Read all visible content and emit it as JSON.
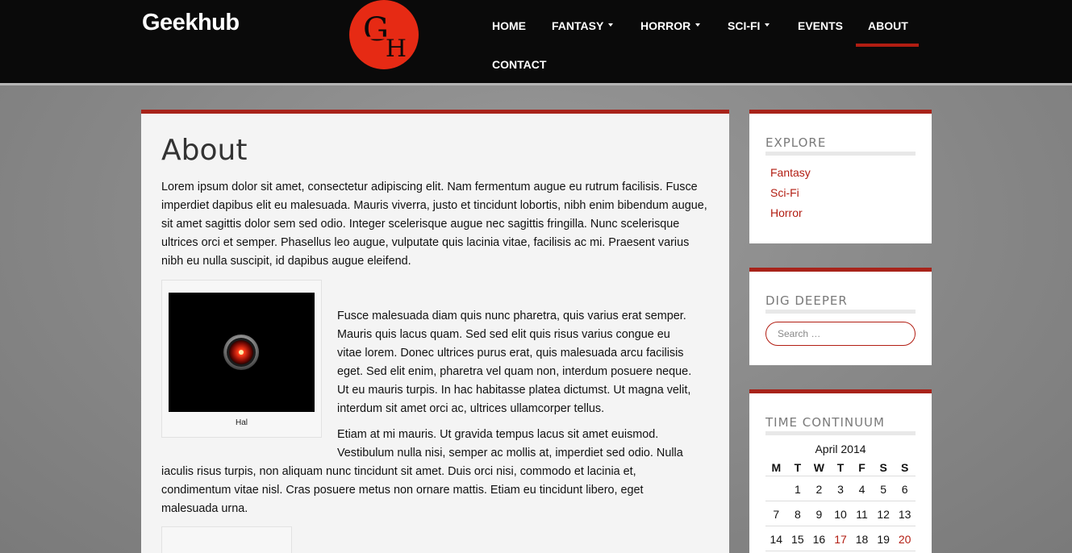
{
  "header": {
    "brand": "Geekhub",
    "logo_text": "GH",
    "nav": [
      {
        "label": "HOME",
        "dropdown": false
      },
      {
        "label": "FANTASY",
        "dropdown": true
      },
      {
        "label": "HORROR",
        "dropdown": true
      },
      {
        "label": "SCI-FI",
        "dropdown": true
      },
      {
        "label": "EVENTS",
        "dropdown": false
      },
      {
        "label": "ABOUT",
        "dropdown": false,
        "active": true
      },
      {
        "label": "CONTACT",
        "dropdown": false
      }
    ]
  },
  "main": {
    "title": "About",
    "paragraph1": "Lorem ipsum dolor sit amet, consectetur adipiscing elit. Nam fermentum augue eu rutrum facilisis. Fusce imperdiet dapibus elit eu malesuada. Mauris viverra, justo et tincidunt lobortis, nibh enim bibendum augue, sit amet sagittis dolor sem sed odio. Integer scelerisque augue nec sagittis fringilla. Nunc scelerisque ultrices orci et semper. Phasellus leo augue, vulputate quis lacinia vitae, facilisis ac mi. Praesent varius nibh eu nulla suscipit, id dapibus augue eleifend.",
    "figure_caption": "Hal",
    "paragraph2": "Fusce malesuada diam quis nunc pharetra, quis varius erat semper. Mauris quis lacus quam. Sed sed elit quis risus varius congue eu vitae lorem. Donec ultrices purus erat, quis malesuada arcu facilisis eget. Sed elit enim, pharetra vel quam non, interdum posuere neque. Ut eu mauris turpis. In hac habitasse platea dictumst. Ut magna velit, interdum sit amet orci ac, ultrices ullamcorper tellus.",
    "paragraph3_start": "Etiam at mi mauris. Ut gravida tempus lacus sit amet euismod. Vestibulum nulla nisi, semper ac mollis at, imperdiet sed odio. Nulla",
    "paragraph3_rest": "iaculis risus turpis, non aliquam nunc tincidunt sit amet. Duis orci nisi, commodo et lacinia et, condimentum vitae nisl. Cras posuere metus non ornare mattis. Etiam eu tincidunt libero, eget malesuada urna."
  },
  "sidebar": {
    "explore": {
      "title": "EXPLORE",
      "links": [
        "Fantasy",
        "Sci-Fi",
        "Horror"
      ]
    },
    "dig_deeper": {
      "title": "DIG DEEPER",
      "search_placeholder": "Search …"
    },
    "time_continuum": {
      "title": "TIME CONTINUUM",
      "caption": "April 2014",
      "weekdays": [
        "M",
        "T",
        "W",
        "T",
        "F",
        "S",
        "S"
      ],
      "weeks": [
        [
          "",
          "1",
          "2",
          "3",
          "4",
          "5",
          "6"
        ],
        [
          "7",
          "8",
          "9",
          "10",
          "11",
          "12",
          "13"
        ],
        [
          "14",
          "15",
          "16",
          "17",
          "18",
          "19",
          "20"
        ]
      ],
      "highlighted_days": [
        "17",
        "20"
      ]
    }
  },
  "colors": {
    "accent": "#b21d12",
    "header_bg": "#0a0a0a",
    "logo_red": "#e62a14"
  }
}
